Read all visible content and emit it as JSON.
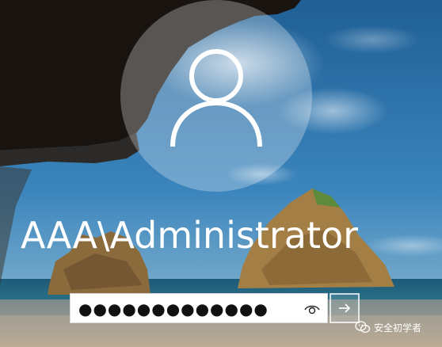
{
  "user": {
    "account_name": "AAA\\Administrator"
  },
  "password": {
    "masked_value": "●●●●●●●●●●●●●"
  },
  "icons": {
    "avatar": "user-silhouette-icon",
    "reveal": "eye-icon",
    "submit": "arrow-right-icon",
    "watermark": "wechat-icon"
  },
  "watermark": {
    "text": "安全初学者"
  },
  "colors": {
    "sky": "#2a6ea6",
    "field_bg": "#ffffff",
    "text": "#ffffff"
  }
}
